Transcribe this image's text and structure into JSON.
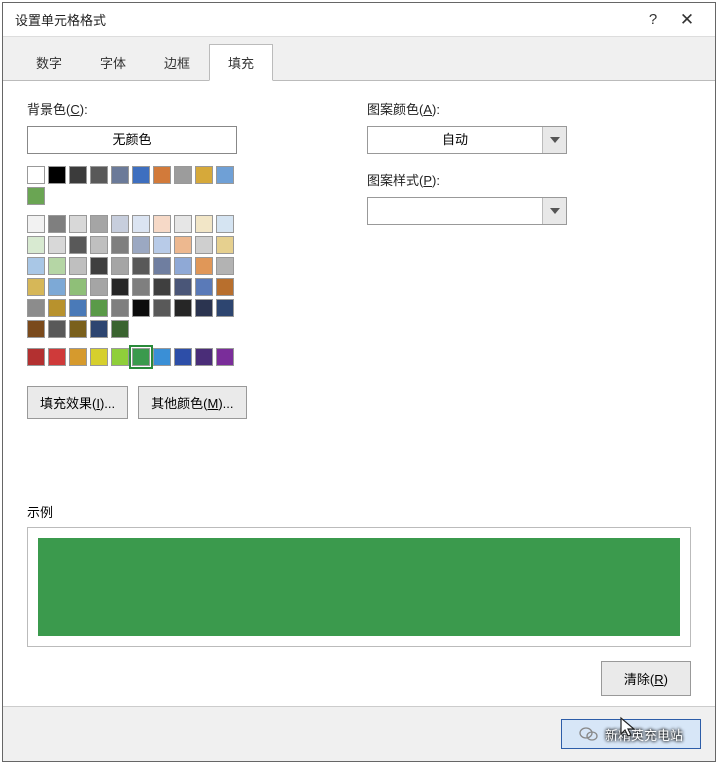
{
  "title": "设置单元格格式",
  "help_icon": "?",
  "close_icon": "✕",
  "tabs": [
    "数字",
    "字体",
    "边框",
    "填充"
  ],
  "active_tab_index": 3,
  "left": {
    "bg_label": "背景色(",
    "bg_key": "C",
    "bg_label_end": "):",
    "no_color": "无颜色",
    "fill_effects": "填充效果(",
    "fill_effects_key": "I",
    "fill_effects_end": ")...",
    "more_colors": "其他颜色(",
    "more_colors_key": "M",
    "more_colors_end": ")..."
  },
  "right": {
    "pattern_color_label": "图案颜色(",
    "pattern_color_key": "A",
    "pattern_color_end": "):",
    "pattern_color_value": "自动",
    "pattern_style_label": "图案样式(",
    "pattern_style_key": "P",
    "pattern_style_end": "):",
    "pattern_style_value": ""
  },
  "sample": {
    "label": "示例",
    "color": "#3b9a4d"
  },
  "clear": {
    "label": "清除(",
    "key": "R",
    "end": ")"
  },
  "ok_overlay": "新精英充电站",
  "palette_row1": [
    "#ffffff",
    "#000000",
    "#3b3b3b",
    "#595959",
    "#6b7a99",
    "#3e6fbf",
    "#d27a3a",
    "#9c9c9c",
    "#d6a93a",
    "#6fa0d6",
    "#6aa553"
  ],
  "palette_main": [
    [
      "#f2f2f2",
      "#7f7f7f",
      "#d8d8d8",
      "#a5a5a5",
      "#c7cedd",
      "#dbe4f2",
      "#f6d9c7",
      "#e6e6e6",
      "#f2e6c7",
      "#d5e4f2",
      "#d8ead1"
    ],
    [
      "#d8d8d8",
      "#595959",
      "#bfbfbf",
      "#7f7f7f",
      "#9ba8c2",
      "#b8cbe8",
      "#edb88f",
      "#cfcfcf",
      "#e6d08f",
      "#a9c7e6",
      "#b5d6a5"
    ],
    [
      "#bfbfbf",
      "#3f3f3f",
      "#a5a5a5",
      "#595959",
      "#6f7ea0",
      "#8fa9d6",
      "#e09758",
      "#b3b3b3",
      "#d6b758",
      "#7da9d6",
      "#8fbf78"
    ],
    [
      "#a5a5a5",
      "#262626",
      "#7f7f7f",
      "#3f3f3f",
      "#4a5678",
      "#5a7ab8",
      "#b86f2d",
      "#8c8c8c",
      "#b8922d",
      "#4a7ab8",
      "#5a9a48"
    ],
    [
      "#7f7f7f",
      "#0c0c0c",
      "#595959",
      "#262626",
      "#2b3450",
      "#2d4570",
      "#7a4a1c",
      "#595959",
      "#7a601c",
      "#2d4570",
      "#3a6330"
    ]
  ],
  "palette_bottom": [
    "#b33030",
    "#cf3a3a",
    "#d69a2d",
    "#d6cf2d",
    "#8fcf3a",
    "#3b9a4d",
    "#3a8fd6",
    "#2d4ea8",
    "#4a2d78",
    "#7a2d9a"
  ],
  "selected_bottom_index": 5
}
